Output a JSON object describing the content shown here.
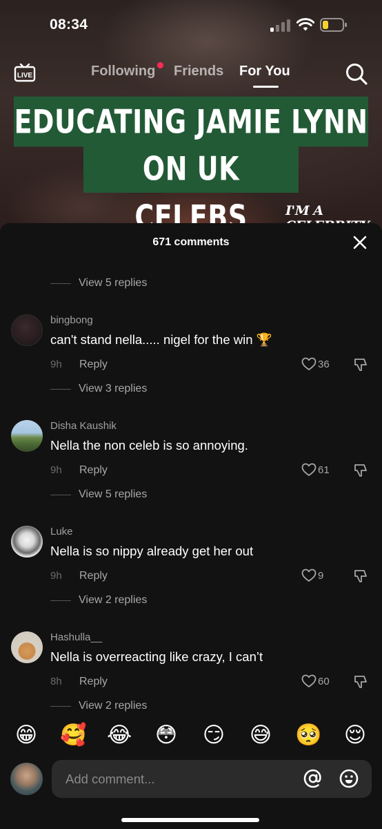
{
  "status_bar": {
    "time": "08:34"
  },
  "top_nav": {
    "tabs": [
      {
        "label": "Following"
      },
      {
        "label": "Friends"
      },
      {
        "label": "For You"
      }
    ],
    "live_label": "LIVE"
  },
  "video": {
    "caption_line1": "EDUCATING JAMIE LYNN",
    "caption_line2": "ON UK CELEBS",
    "logo_text": "I'M A CELEBRITY",
    "banner_color": "#235a36"
  },
  "comments_panel": {
    "title": "671 comments",
    "top_view_replies": "View 5 replies",
    "comments": [
      {
        "username": "bingbong",
        "text": "can't stand nella..... nigel for the win 🏆",
        "time": "9h",
        "reply_label": "Reply",
        "likes": "36",
        "view_replies": "View 3 replies"
      },
      {
        "username": "Disha Kaushik",
        "text": "Nella the non celeb is so annoying.",
        "time": "9h",
        "reply_label": "Reply",
        "likes": "61",
        "view_replies": "View 5 replies"
      },
      {
        "username": "Luke",
        "text": "Nella is so nippy already get her out",
        "time": "9h",
        "reply_label": "Reply",
        "likes": "9",
        "view_replies": "View 2 replies"
      },
      {
        "username": "Hashulla__",
        "text": "Nella is overreacting like crazy, I can’t",
        "time": "8h",
        "reply_label": "Reply",
        "likes": "60",
        "view_replies": "View 2 replies"
      }
    ]
  },
  "emoji_bar": [
    "😁",
    "🥰",
    "😂",
    "😳",
    "😏",
    "😅",
    "🥺",
    "😌"
  ],
  "input": {
    "placeholder": "Add comment..."
  },
  "colors": {
    "sheet_bg": "#121212",
    "accent": "#fe2c55",
    "input_bg": "#2b2b2b"
  }
}
